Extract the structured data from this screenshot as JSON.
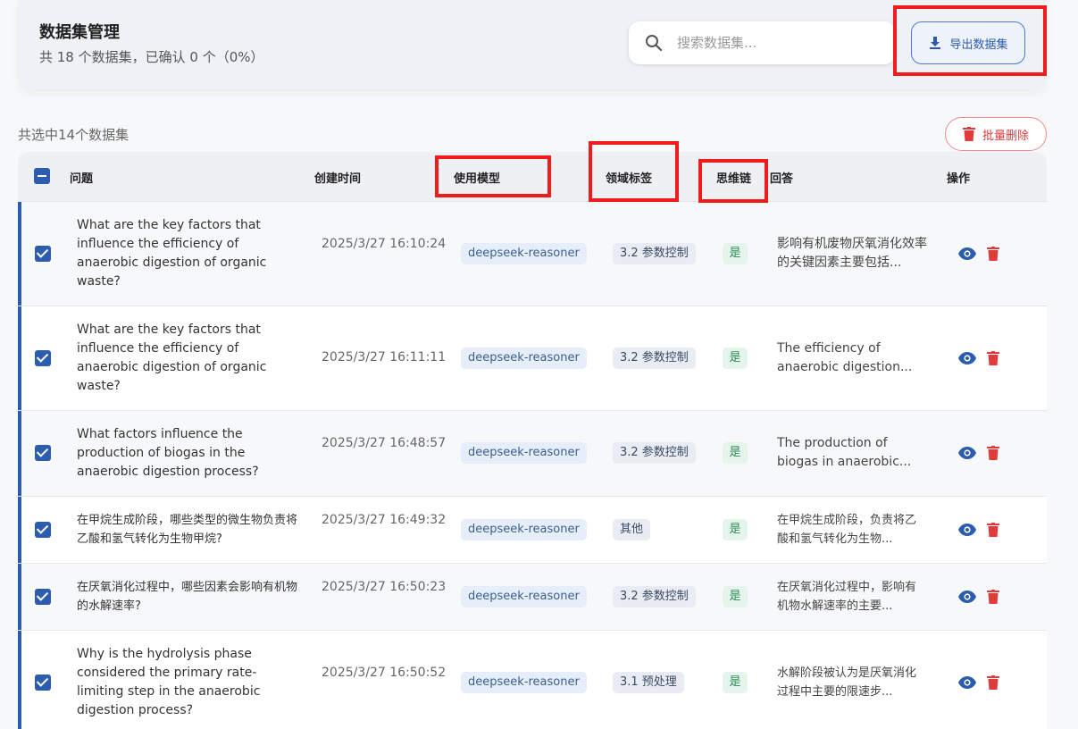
{
  "header": {
    "title": "数据集管理",
    "subtitle": "共 18 个数据集，已确认 0 个（0%）",
    "search_placeholder": "搜索数据集...",
    "export_label": "导出数据集"
  },
  "toolbar": {
    "selected_text": "共选中14个数据集",
    "bulk_delete_label": "批量删除"
  },
  "table": {
    "columns": {
      "question": "问题",
      "created": "创建时间",
      "model": "使用模型",
      "tag": "领域标签",
      "cot": "思维链",
      "answer": "回答",
      "actions": "操作"
    },
    "rows": [
      {
        "question": "What are the key factors that influence the efficiency of anaerobic digestion of organic waste?",
        "created": "2025/3/27 16:10:24",
        "model": "deepseek-reasoner",
        "tag": "3.2 参数控制",
        "cot": "是",
        "answer": "影响有机废物厌氧消化效率的关键因素主要包括..."
      },
      {
        "question": "What are the key factors that influence the efficiency of anaerobic digestion of organic waste?",
        "created": "2025/3/27 16:11:11",
        "model": "deepseek-reasoner",
        "tag": "3.2 参数控制",
        "cot": "是",
        "answer": "The efficiency of anaerobic digestion..."
      },
      {
        "question": "What factors influence the production of biogas in the anaerobic digestion process?",
        "created": "2025/3/27 16:48:57",
        "model": "deepseek-reasoner",
        "tag": "3.2 参数控制",
        "cot": "是",
        "answer": "The production of biogas in anaerobic..."
      },
      {
        "question": "在甲烷生成阶段，哪些类型的微生物负责将乙酸和氢气转化为生物甲烷?",
        "created": "2025/3/27 16:49:32",
        "model": "deepseek-reasoner",
        "tag": "其他",
        "cot": "是",
        "answer": "在甲烷生成阶段，负责将乙酸和氢气转化为生物..."
      },
      {
        "question": "在厌氧消化过程中，哪些因素会影响有机物的水解速率?",
        "created": "2025/3/27 16:50:23",
        "model": "deepseek-reasoner",
        "tag": "3.2 参数控制",
        "cot": "是",
        "answer": "在厌氧消化过程中，影响有机物水解速率的主要..."
      },
      {
        "question": "Why is the hydrolysis phase considered the primary rate-limiting step in the anaerobic digestion process?",
        "created": "2025/3/27 16:50:52",
        "model": "deepseek-reasoner",
        "tag": "3.1 预处理",
        "cot": "是",
        "answer": "水解阶段被认为是厌氧消化过程中主要的限速步..."
      }
    ]
  },
  "colors": {
    "primary": "#2b5cae",
    "danger": "#e03a3a",
    "highlight_box": "#f01c1c"
  }
}
